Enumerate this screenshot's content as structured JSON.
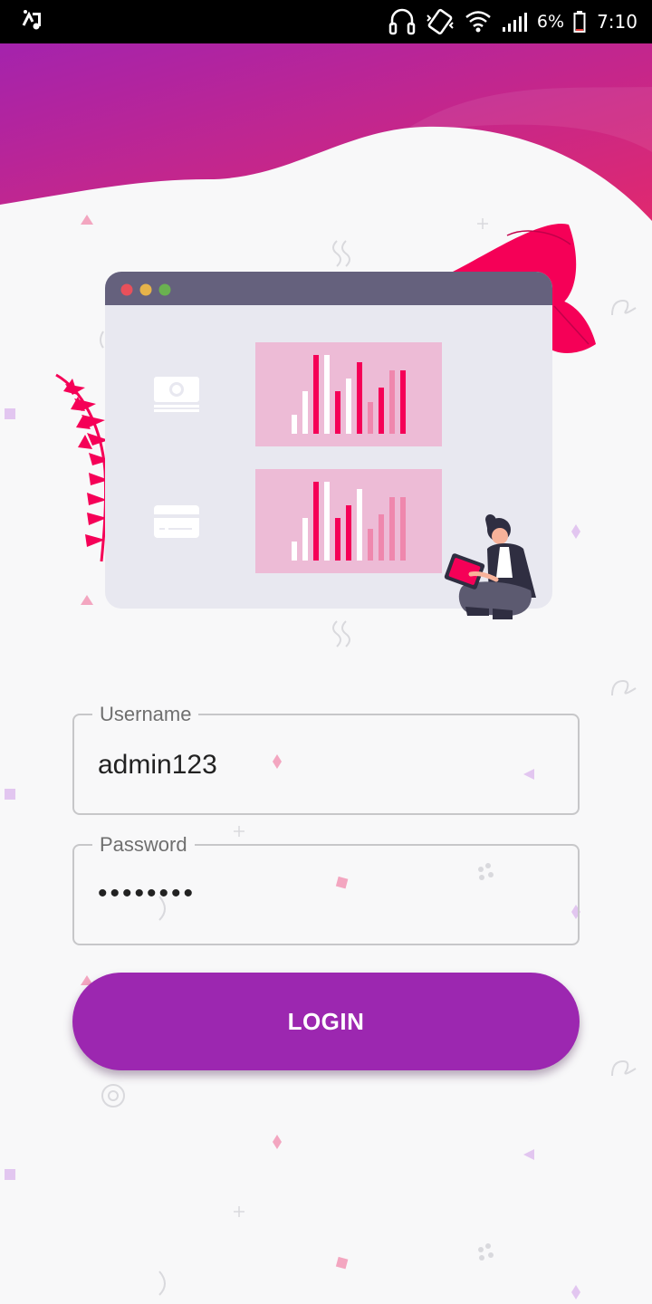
{
  "status_bar": {
    "battery_percent": "6%",
    "time": "7:10",
    "icons": [
      "music-notification-icon",
      "headset-icon",
      "vibrate-icon",
      "wifi-icon",
      "signal-icon",
      "battery-icon"
    ]
  },
  "theme": {
    "header_gradient_start": "#a423ad",
    "header_gradient_end": "#e0296f",
    "accent": "#9c27b0",
    "chart_panel": "#edbbd6",
    "chart_dark": "#f50057",
    "window_titlebar": "#65617d",
    "window_body": "#e8e8f0"
  },
  "form": {
    "username": {
      "label": "Username",
      "value": "admin123"
    },
    "password": {
      "label": "Password",
      "value": "••••••••"
    }
  },
  "login_button": {
    "label": "LOGIN"
  }
}
